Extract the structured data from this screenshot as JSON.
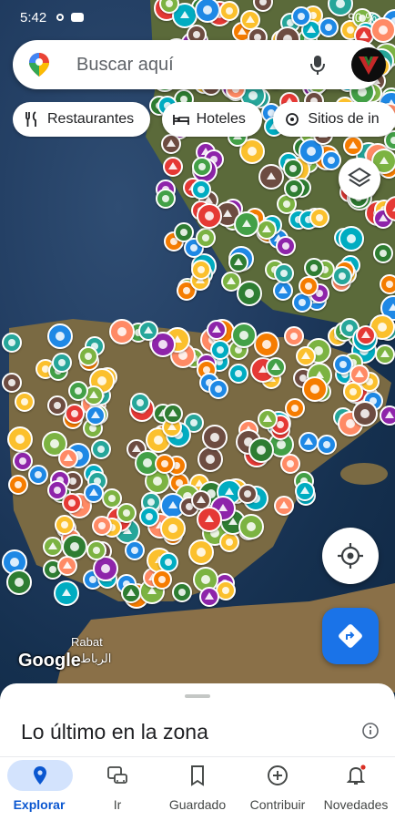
{
  "status_bar": {
    "time": "5:42",
    "battery": "90 %"
  },
  "search": {
    "placeholder": "Buscar aquí",
    "logo_icon": "maps-pin-icon",
    "mic_icon": "mic-icon",
    "account_icon": "account-avatar"
  },
  "chips": [
    {
      "label": "Restaurantes",
      "icon": "fork-knife-icon"
    },
    {
      "label": "Hoteles",
      "icon": "bed-icon"
    },
    {
      "label": "Sitios de in",
      "icon": "landmark-icon"
    }
  ],
  "map": {
    "watermark": "Google",
    "city_label": "Rabat",
    "city_label_ar": "الرباط",
    "layers_icon": "layers-icon",
    "locate_icon": "my-location-icon",
    "directions_icon": "directions-icon",
    "accent_color": "#1a73e8"
  },
  "sheet": {
    "title": "Lo último en la zona",
    "info_icon": "info-icon"
  },
  "nav": {
    "items": [
      {
        "label": "Explorar",
        "icon": "location-pin-icon",
        "active": true
      },
      {
        "label": "Ir",
        "icon": "commute-icon",
        "active": false
      },
      {
        "label": "Guardado",
        "icon": "bookmark-icon",
        "active": false
      },
      {
        "label": "Contribuir",
        "icon": "add-circle-icon",
        "active": false
      },
      {
        "label": "Novedades",
        "icon": "bell-icon",
        "active": false
      }
    ]
  }
}
